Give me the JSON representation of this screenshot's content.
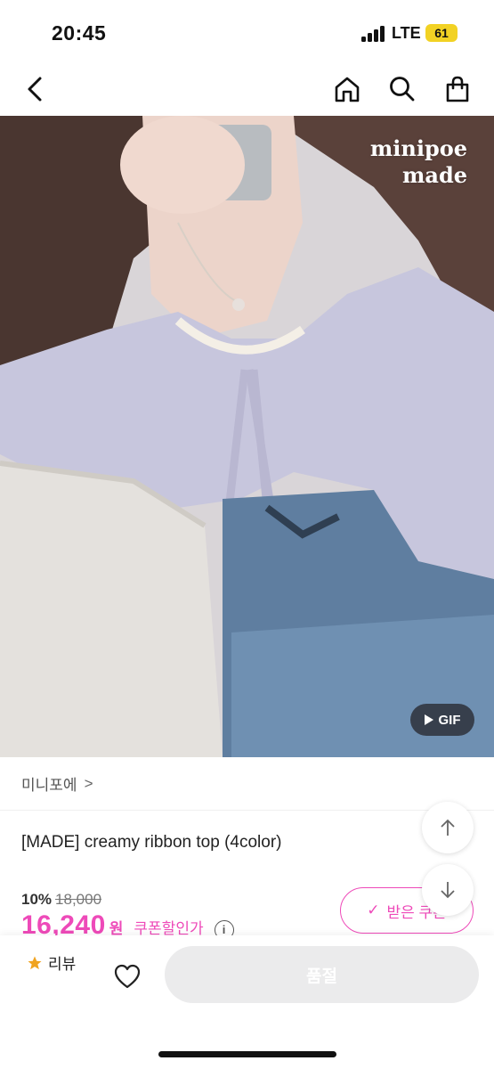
{
  "status_bar": {
    "time": "20:45",
    "network": "LTE",
    "battery": "61"
  },
  "nav": {
    "back_icon": "chevron-left-icon",
    "home_icon": "home-icon",
    "search_icon": "search-icon",
    "cart_icon": "shopping-bag-icon"
  },
  "hero": {
    "watermark_line1": "minipoe",
    "watermark_line2": "made",
    "gif_label": "GIF"
  },
  "seller": {
    "name": "미니포에",
    "chevron": ">"
  },
  "product": {
    "title": "[MADE] creamy ribbon top (4color)",
    "discount_rate": "10%",
    "original_price": "18,000",
    "price": "16,240",
    "currency": "원",
    "coupon_price_label": "쿠폰할인가",
    "info_icon": "i"
  },
  "coupon_button": {
    "label": "받은 쿠폰",
    "check": "✓"
  },
  "scroll": {
    "up_icon": "arrow-up-icon",
    "down_icon": "arrow-down-icon"
  },
  "bottom_bar": {
    "review_label": "리뷰",
    "star_icon": "star-icon",
    "heart_icon": "heart-icon",
    "soldout_label": "품절"
  },
  "colors": {
    "accent": "#ee4ab9",
    "battery": "#f2d224"
  }
}
